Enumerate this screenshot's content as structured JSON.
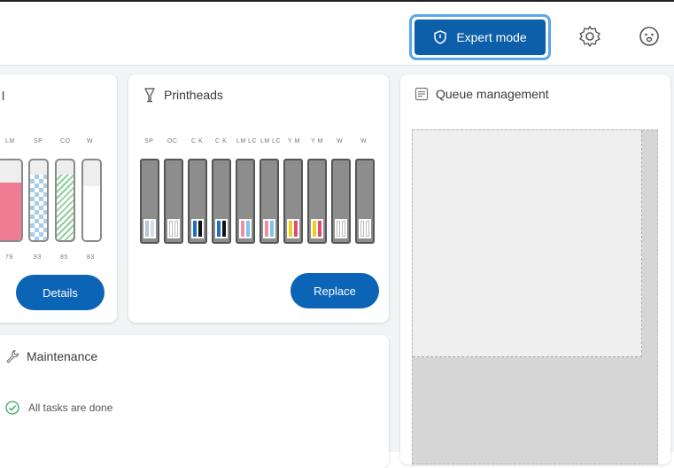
{
  "header": {
    "expert_mode_label": "Expert mode",
    "settings_icon": "gear-icon",
    "account_icon": "face-icon"
  },
  "ink_card": {
    "title": "l",
    "codes": [
      "LM",
      "SP",
      "CO",
      "W"
    ],
    "levels_text": [
      "79",
      "83",
      "85",
      "83"
    ],
    "details_label": "Details"
  },
  "printheads": {
    "title": "Printheads",
    "codes": [
      "SP",
      "OC",
      "C K",
      "C K",
      "LM LC",
      "LM LC",
      "Y M",
      "Y M",
      "W",
      "W"
    ],
    "replace_label": "Replace"
  },
  "queue": {
    "title": "Queue management"
  },
  "maintenance": {
    "title": "Maintenance",
    "status": "All tasks are done"
  },
  "colors": {
    "accent": "#0c64b6",
    "cyan": "#1d6fc4",
    "magenta": "#e24b70",
    "yellow": "#f2cf1f",
    "black": "#111111",
    "light_magenta": "#f08ba0",
    "light_cyan": "#7fc3ea",
    "success": "#3aa55b"
  }
}
